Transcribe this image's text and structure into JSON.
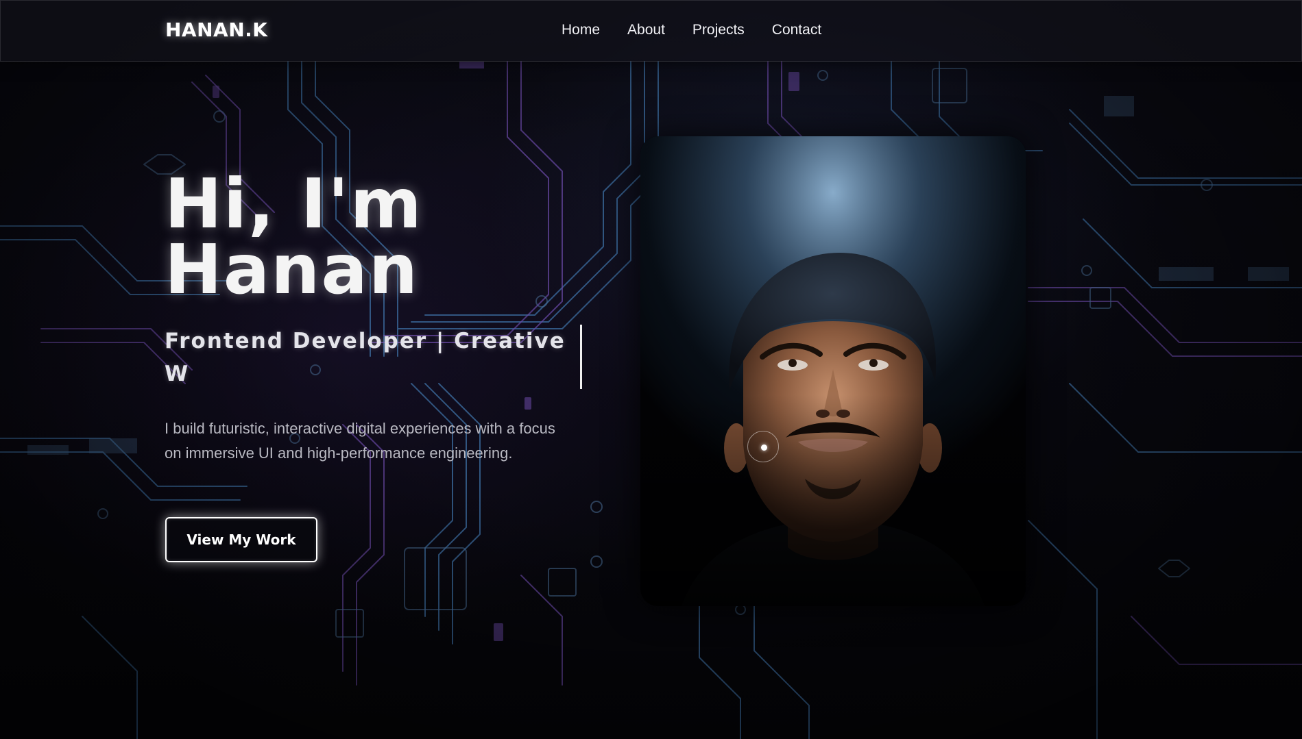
{
  "header": {
    "brand": "HANAN.K",
    "nav": [
      {
        "label": "Home"
      },
      {
        "label": "About"
      },
      {
        "label": "Projects"
      },
      {
        "label": "Contact"
      }
    ]
  },
  "hero": {
    "title_line1": "Hi, I'm",
    "title_line2": "Hanan",
    "tagline": "Frontend Developer | Creative W",
    "description": "I build futuristic, interactive digital experiences with a focus on immersive UI and high-performance engineering.",
    "cta_label": "View My Work"
  },
  "portrait": {
    "icon": "portrait-photo"
  },
  "colors": {
    "background": "#07070c",
    "circuit_purple": "#6a4a9e",
    "circuit_blue": "#3f7fb0",
    "text_primary": "#ffffff",
    "text_muted": "#b9b9c2"
  }
}
